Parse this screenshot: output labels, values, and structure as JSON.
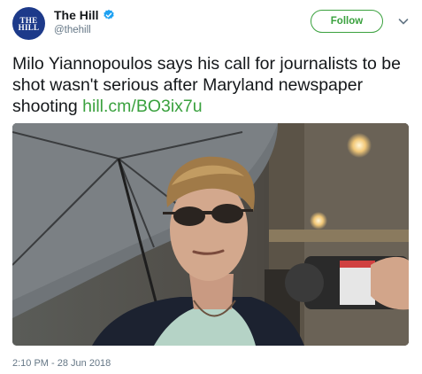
{
  "account": {
    "avatar_text": [
      "THE",
      "HILL"
    ],
    "display_name": "The Hill",
    "handle": "@thehill"
  },
  "actions": {
    "follow_label": "Follow"
  },
  "tweet": {
    "text": "Milo Yiannopoulos says his call for journalists to be shot wasn't serious after Maryland newspaper shooting",
    "link": "hill.cm/BO3ix7u",
    "timestamp": "2:10 PM - 28 Jun 2018"
  },
  "icons": {
    "verified": "verified-badge-icon",
    "caret": "chevron-down-icon"
  },
  "colors": {
    "accent": "#3aa13e",
    "avatar_bg": "#1d3a8a",
    "verified": "#1da1f2",
    "muted": "#657786"
  }
}
